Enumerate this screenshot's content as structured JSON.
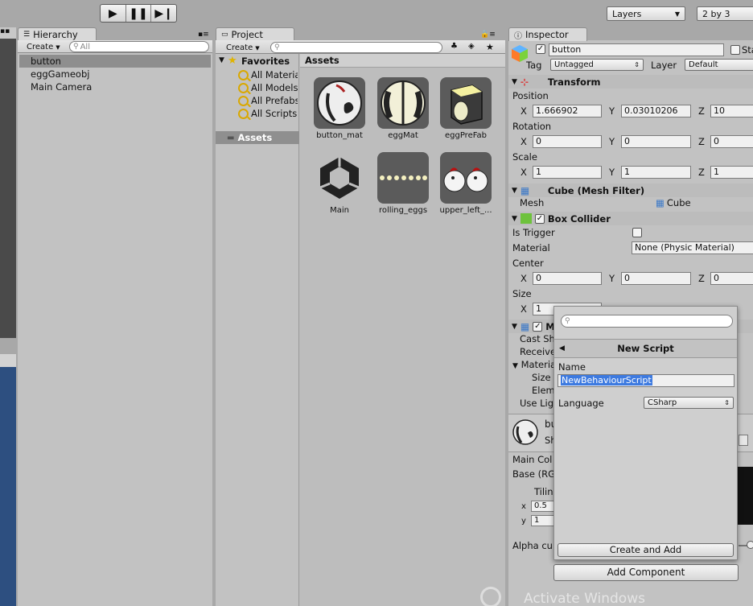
{
  "toolbar": {
    "layers_label": "Layers",
    "layout_label": "2 by 3"
  },
  "hierarchy": {
    "tab_label": "Hierarchy",
    "create_label": "Create",
    "search_placeholder": "All",
    "items": [
      {
        "label": "button",
        "selected": true
      },
      {
        "label": "eggGameobj",
        "selected": false
      },
      {
        "label": "Main Camera",
        "selected": false
      }
    ]
  },
  "project": {
    "tab_label": "Project",
    "create_label": "Create",
    "favorites_label": "Favorites",
    "favorites": [
      "All Materials",
      "All Models",
      "All Prefabs",
      "All Scripts"
    ],
    "assets_folder_label": "Assets",
    "assets_header": "Assets",
    "assets": [
      {
        "name": "button_mat",
        "icon": "material-icon"
      },
      {
        "name": "eggMat",
        "icon": "material-icon"
      },
      {
        "name": "eggPreFab",
        "icon": "prefab-icon"
      },
      {
        "name": "Main",
        "icon": "unity-scene-icon"
      },
      {
        "name": "rolling_eggs",
        "icon": "texture-icon"
      },
      {
        "name": "upper_left_...",
        "icon": "texture-icon"
      }
    ]
  },
  "inspector": {
    "tab_label": "Inspector",
    "object_name": "button",
    "static_label": "Static",
    "tag_label": "Tag",
    "tag_value": "Untagged",
    "layer_label": "Layer",
    "layer_value": "Default",
    "transform": {
      "title": "Transform",
      "position_label": "Position",
      "rotation_label": "Rotation",
      "scale_label": "Scale",
      "position": {
        "x": "1.666902",
        "y": "0.03010206",
        "z": "10"
      },
      "rotation": {
        "x": "0",
        "y": "0",
        "z": "0"
      },
      "scale": {
        "x": "1",
        "y": "1",
        "z": "1"
      }
    },
    "mesh_filter": {
      "title": "Cube (Mesh Filter)",
      "mesh_label": "Mesh",
      "mesh_value": "Cube"
    },
    "box_collider": {
      "title": "Box Collider",
      "is_trigger_label": "Is Trigger",
      "material_label": "Material",
      "material_value": "None (Physic Material)",
      "center_label": "Center",
      "center": {
        "x": "0",
        "y": "0",
        "z": "0"
      },
      "size_label": "Size",
      "size": {
        "x": "1"
      }
    },
    "mesh_renderer": {
      "title_partial": "M",
      "cast_partial": "Cast Sh",
      "receive_partial": "Receive",
      "materials_partial": "Materia",
      "size_partial": "Size",
      "element_partial": "Elem",
      "use_light_partial": "Use Lig"
    },
    "material": {
      "name_partial": "bu",
      "shader_partial": "Sh",
      "main_color_partial": "Main Col",
      "base_partial": "Base (RG",
      "tiling_partial": "Tilin",
      "tiling_x": "0.5",
      "tiling_y": "1",
      "alpha_partial": "Alpha cu"
    },
    "add_component_label": "Add Component"
  },
  "new_script_popup": {
    "title": "New Script",
    "name_label": "Name",
    "name_value": "NewBehaviourScript",
    "language_label": "Language",
    "language_value": "CSharp",
    "create_button_label": "Create and Add"
  },
  "watermark": {
    "text": "Activate Windows"
  }
}
